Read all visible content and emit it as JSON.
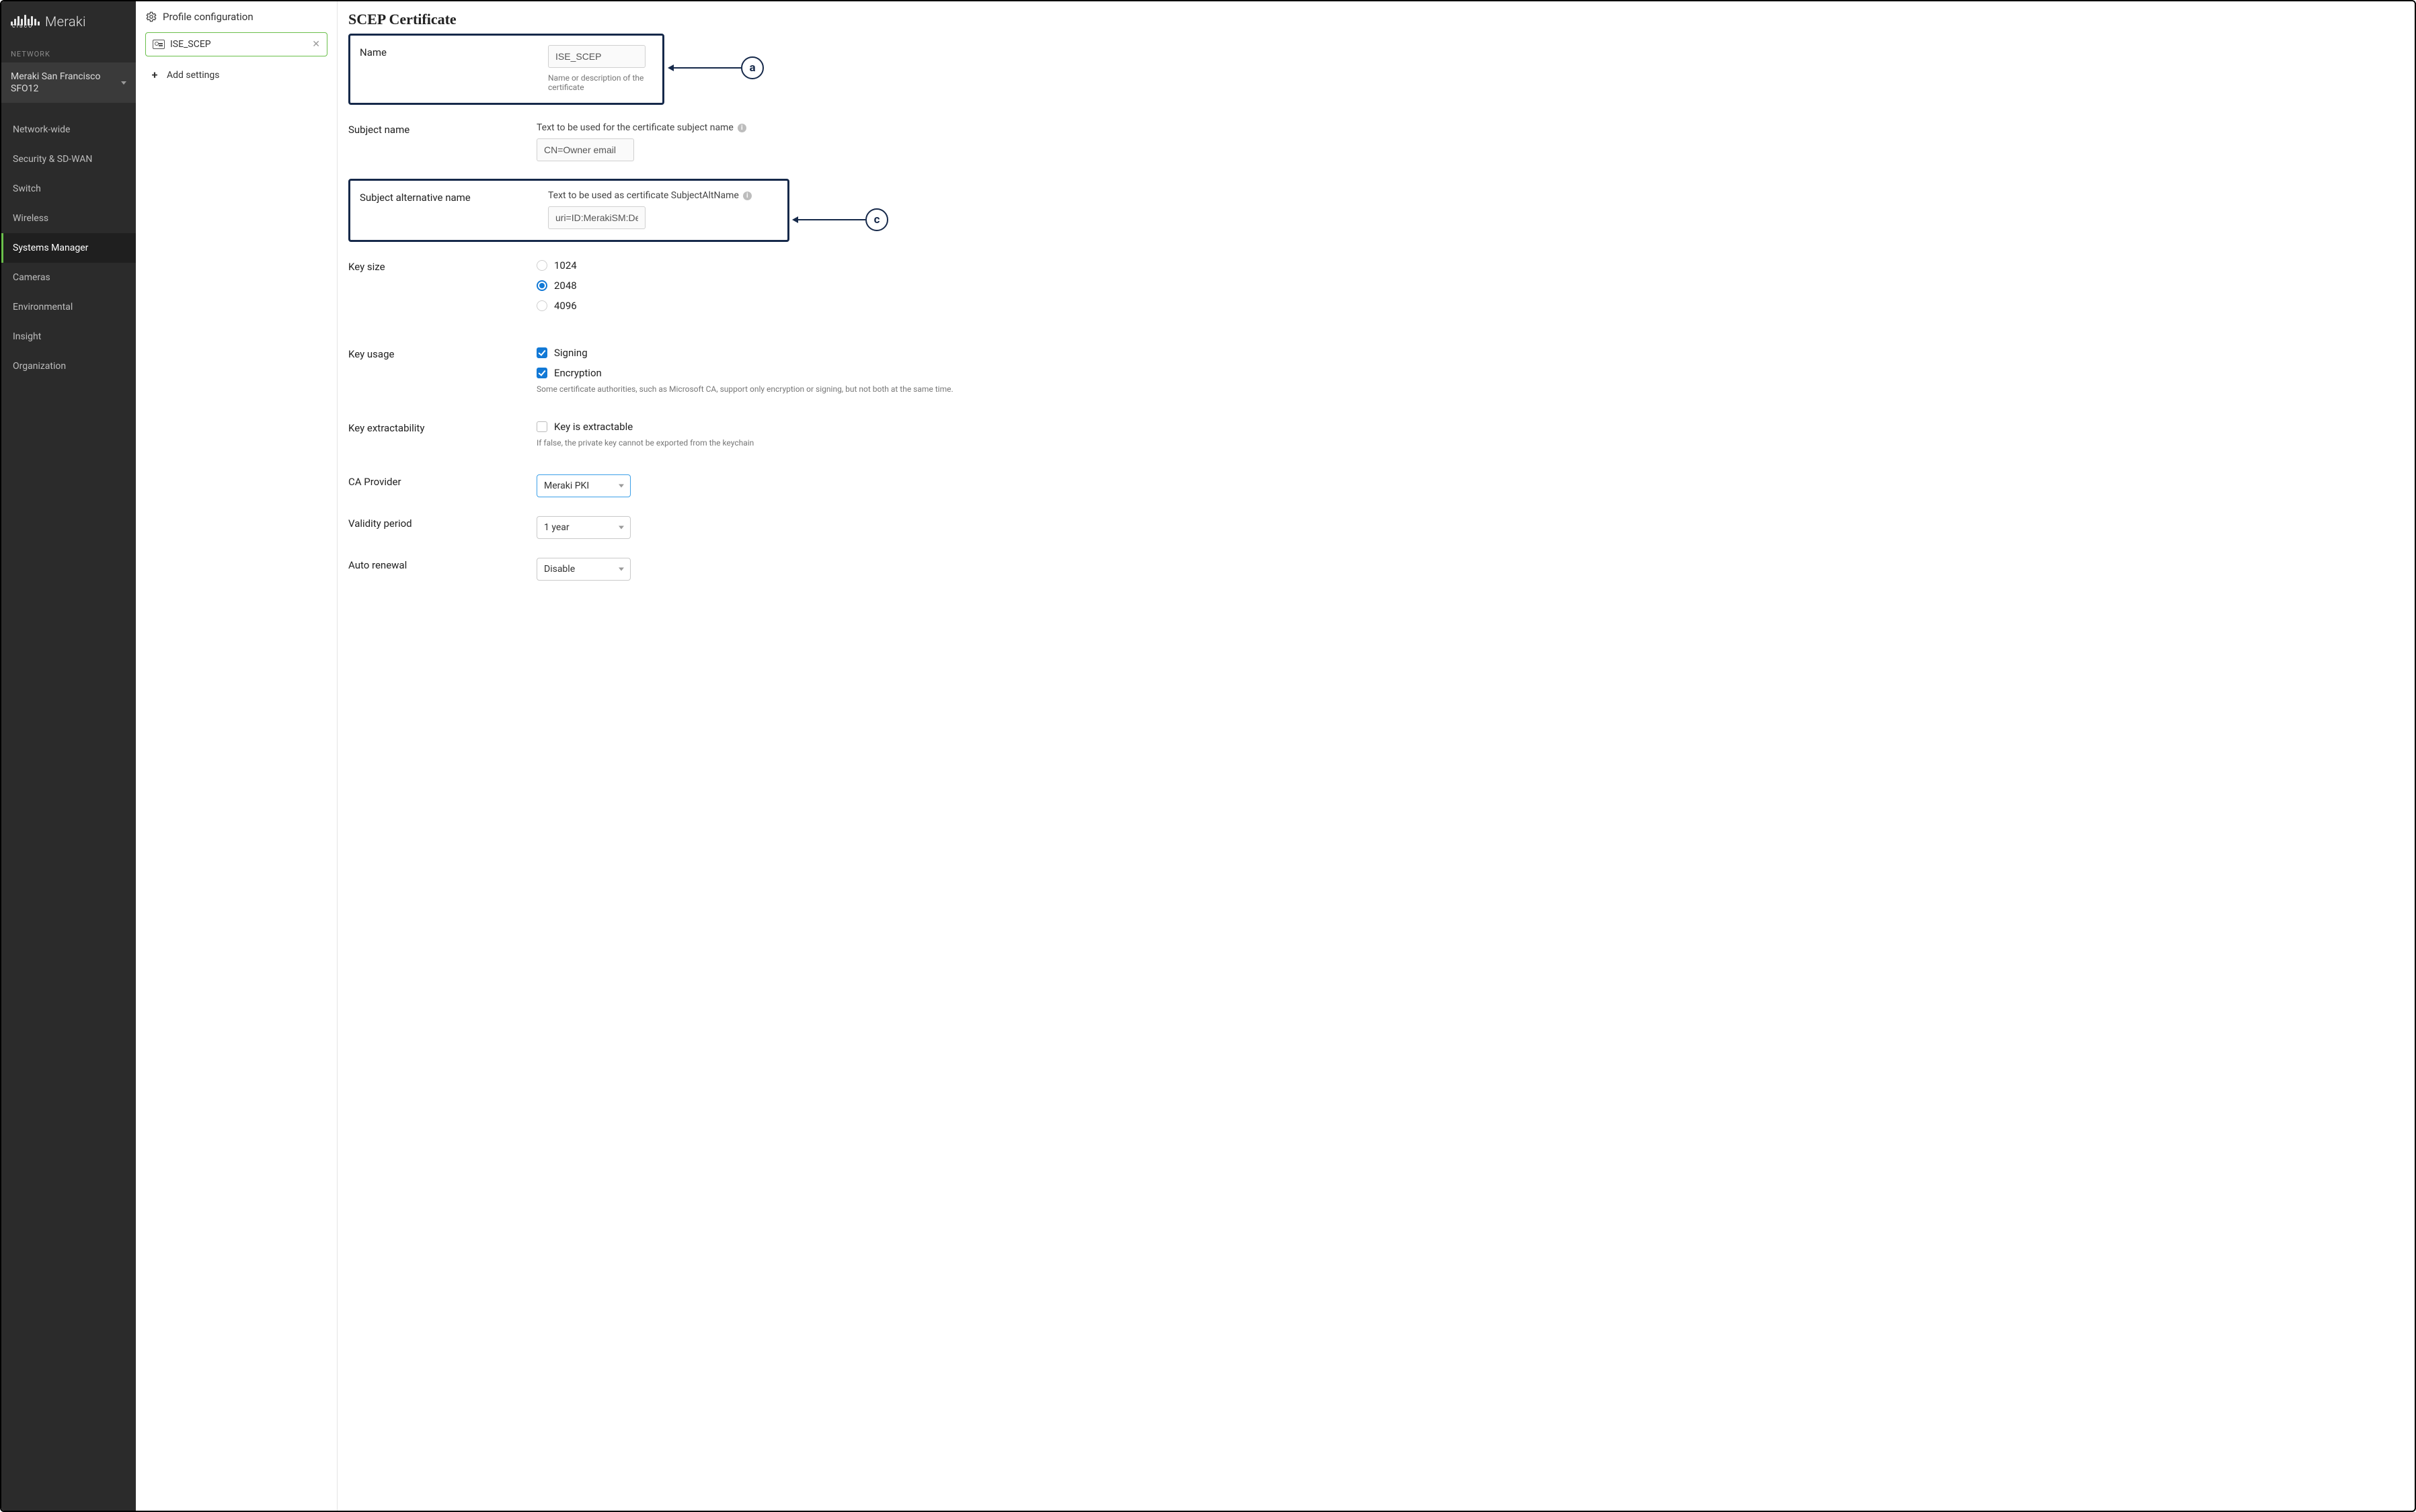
{
  "brand": {
    "vendor": "cisco",
    "product": "Meraki"
  },
  "sidebar": {
    "section_label": "NETWORK",
    "network_name": "Meraki San Francisco SFO12",
    "items": [
      {
        "label": "Network-wide",
        "active": false
      },
      {
        "label": "Security & SD-WAN",
        "active": false
      },
      {
        "label": "Switch",
        "active": false
      },
      {
        "label": "Wireless",
        "active": false
      },
      {
        "label": "Systems Manager",
        "active": true
      },
      {
        "label": "Cameras",
        "active": false
      },
      {
        "label": "Environmental",
        "active": false
      },
      {
        "label": "Insight",
        "active": false
      },
      {
        "label": "Organization",
        "active": false
      }
    ]
  },
  "settings": {
    "header": "Profile configuration",
    "selected_setting": "ISE_SCEP",
    "add_label": "Add settings"
  },
  "annotations": {
    "a_label": "a",
    "c_label": "c"
  },
  "form": {
    "title": "SCEP Certificate",
    "name": {
      "label": "Name",
      "value": "ISE_SCEP",
      "helper": "Name or description of the certificate"
    },
    "subject_name": {
      "label": "Subject name",
      "hint": "Text to be used for the certificate subject name",
      "value": "CN=Owner email"
    },
    "san": {
      "label": "Subject alternative name",
      "hint": "Text to be used as certificate SubjectAltName",
      "value": "uri=ID:MerakiSM:DeviceID:SM device ID"
    },
    "key_size": {
      "label": "Key size",
      "options": [
        "1024",
        "2048",
        "4096"
      ],
      "selected": "2048"
    },
    "key_usage": {
      "label": "Key usage",
      "signing_label": "Signing",
      "signing_checked": true,
      "encryption_label": "Encryption",
      "encryption_checked": true,
      "helper": "Some certificate authorities, such as Microsoft CA, support only encryption or signing, but not both at the same time."
    },
    "key_extract": {
      "label": "Key extractability",
      "option_label": "Key is extractable",
      "checked": false,
      "helper": "If false, the private key cannot be exported from the keychain"
    },
    "ca_provider": {
      "label": "CA Provider",
      "value": "Meraki PKI"
    },
    "validity": {
      "label": "Validity period",
      "value": "1 year"
    },
    "auto_renewal": {
      "label": "Auto renewal",
      "value": "Disable"
    }
  }
}
